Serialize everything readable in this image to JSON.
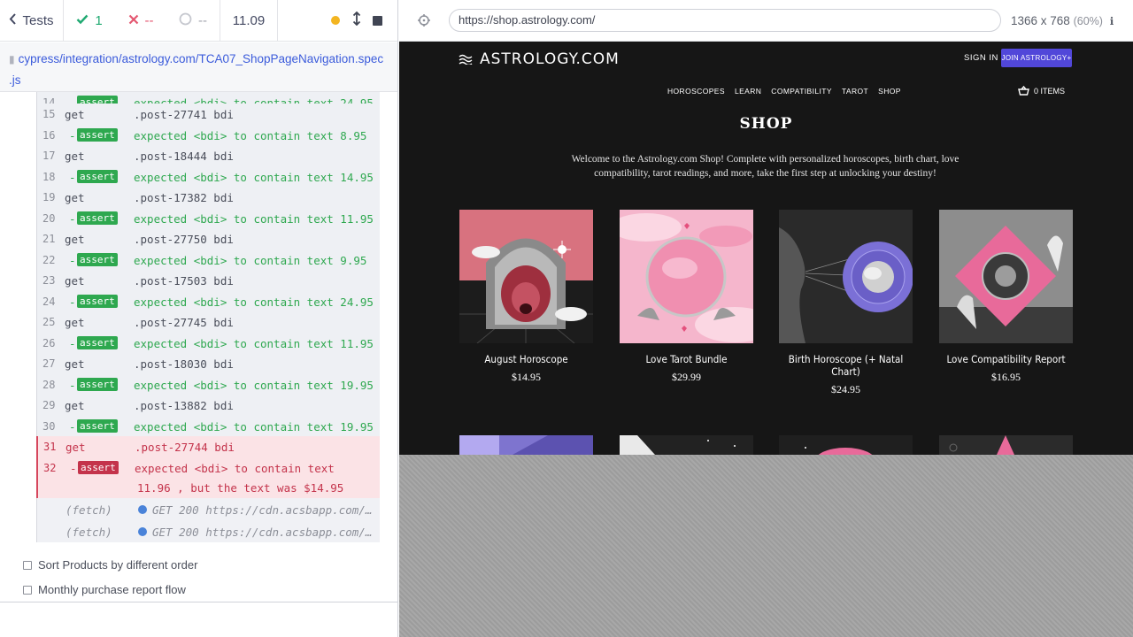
{
  "reporter": {
    "header": {
      "back_label": "Tests",
      "passed": "1",
      "failed": "--",
      "pending": "--",
      "duration": "11.09"
    },
    "spec_path_line1": "cypress/integration/astrology.com/TCA07_ShopPageNavigation.spec",
    "spec_path_line2": ".js",
    "commands": [
      {
        "num": "14",
        "type": "assert",
        "msg": "expected <bdi> to contain text 24.95",
        "clip": true
      },
      {
        "num": "15",
        "type": "get",
        "msg": ".post-27741 bdi"
      },
      {
        "num": "16",
        "type": "assert",
        "msg": "expected <bdi> to contain text 8.95"
      },
      {
        "num": "17",
        "type": "get",
        "msg": ".post-18444 bdi"
      },
      {
        "num": "18",
        "type": "assert",
        "msg": "expected <bdi> to contain text 14.95"
      },
      {
        "num": "19",
        "type": "get",
        "msg": ".post-17382 bdi"
      },
      {
        "num": "20",
        "type": "assert",
        "msg": "expected <bdi> to contain text 11.95"
      },
      {
        "num": "21",
        "type": "get",
        "msg": ".post-27750 bdi"
      },
      {
        "num": "22",
        "type": "assert",
        "msg": "expected <bdi> to contain text 9.95"
      },
      {
        "num": "23",
        "type": "get",
        "msg": ".post-17503 bdi"
      },
      {
        "num": "24",
        "type": "assert",
        "msg": "expected <bdi> to contain text 24.95"
      },
      {
        "num": "25",
        "type": "get",
        "msg": ".post-27745 bdi"
      },
      {
        "num": "26",
        "type": "assert",
        "msg": "expected <bdi> to contain text 11.95"
      },
      {
        "num": "27",
        "type": "get",
        "msg": ".post-18030 bdi"
      },
      {
        "num": "28",
        "type": "assert",
        "msg": "expected <bdi> to contain text 19.95"
      },
      {
        "num": "29",
        "type": "get",
        "msg": ".post-13882 bdi"
      },
      {
        "num": "30",
        "type": "assert",
        "msg": "expected <bdi> to contain text 19.95"
      }
    ],
    "failed_get": {
      "num": "31",
      "type": "get",
      "msg": ".post-27744 bdi"
    },
    "failed_assert": {
      "num": "32",
      "type": "assert",
      "msg": "expected <bdi> to contain text",
      "msg2": "11.96 , but the text was  $14.95"
    },
    "fetches": [
      {
        "label": "(fetch)",
        "msg": "GET 200 https://cdn.acsbapp.com/c..."
      },
      {
        "label": "(fetch)",
        "msg": "GET 200 https://cdn.acsbapp.com/c..."
      }
    ],
    "other_tests": [
      "Sort Products by different order",
      "Monthly purchase report flow"
    ]
  },
  "aut": {
    "url": "https://shop.astrology.com/",
    "viewport": "1366 x 768",
    "scale": "(60%)"
  },
  "site": {
    "logo": "ASTROLOGY.COM",
    "sign_in": "SIGN IN",
    "join": "JOIN ASTROLOGY+",
    "nav": [
      "HOROSCOPES",
      "LEARN",
      "COMPATIBILITY",
      "TAROT",
      "SHOP"
    ],
    "cart": "0 ITEMS",
    "title": "SHOP",
    "description": "Welcome to the Astrology.com Shop! Complete with personalized horoscopes, birth chart, love compatibility, tarot readings, and more, take the first step at unlocking your destiny!",
    "products": [
      {
        "name": "August Horoscope",
        "price": "$14.95"
      },
      {
        "name": "Love Tarot Bundle",
        "price": "$29.99"
      },
      {
        "name": "Birth Horoscope (+ Natal Chart)",
        "price": "$24.95"
      },
      {
        "name": "Love Compatibility Report",
        "price": "$16.95"
      }
    ]
  },
  "colors": {
    "pass": "#1fa971",
    "fail": "#e45770",
    "assert_green": "#2ea84f",
    "fail_red": "#c4334b",
    "site_bg": "#161616",
    "join_purple": "#5147d9",
    "pink": "#e86a9a"
  }
}
